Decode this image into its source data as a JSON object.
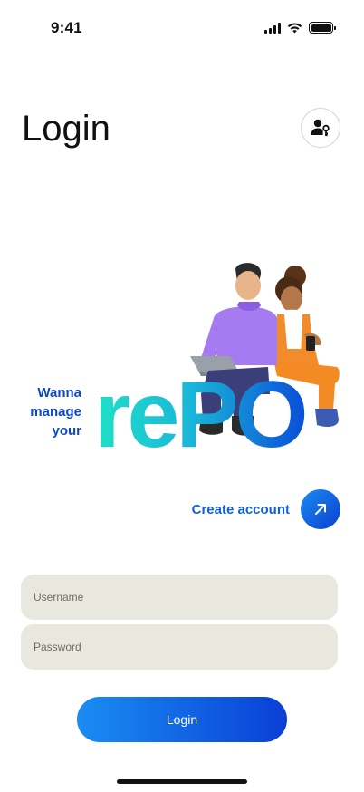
{
  "status_bar": {
    "time": "9:41"
  },
  "header": {
    "title": "Login"
  },
  "hero": {
    "tagline_lines": [
      "Wanna",
      "manage",
      "your"
    ],
    "wordmark": "rePO"
  },
  "create_account": {
    "label": "Create account"
  },
  "form": {
    "username_placeholder": "Username",
    "password_placeholder": "Password",
    "username_value": "",
    "password_value": "",
    "login_label": "Login"
  },
  "colors": {
    "accent_blue": "#0b3fcf",
    "accent_light_blue": "#1a8df3",
    "wordmark_teal": "#1fd8c7",
    "field_background": "#e9e8df"
  },
  "icons": {
    "profile_button": "user-key-icon",
    "create_account_button": "arrow-up-right-icon"
  }
}
